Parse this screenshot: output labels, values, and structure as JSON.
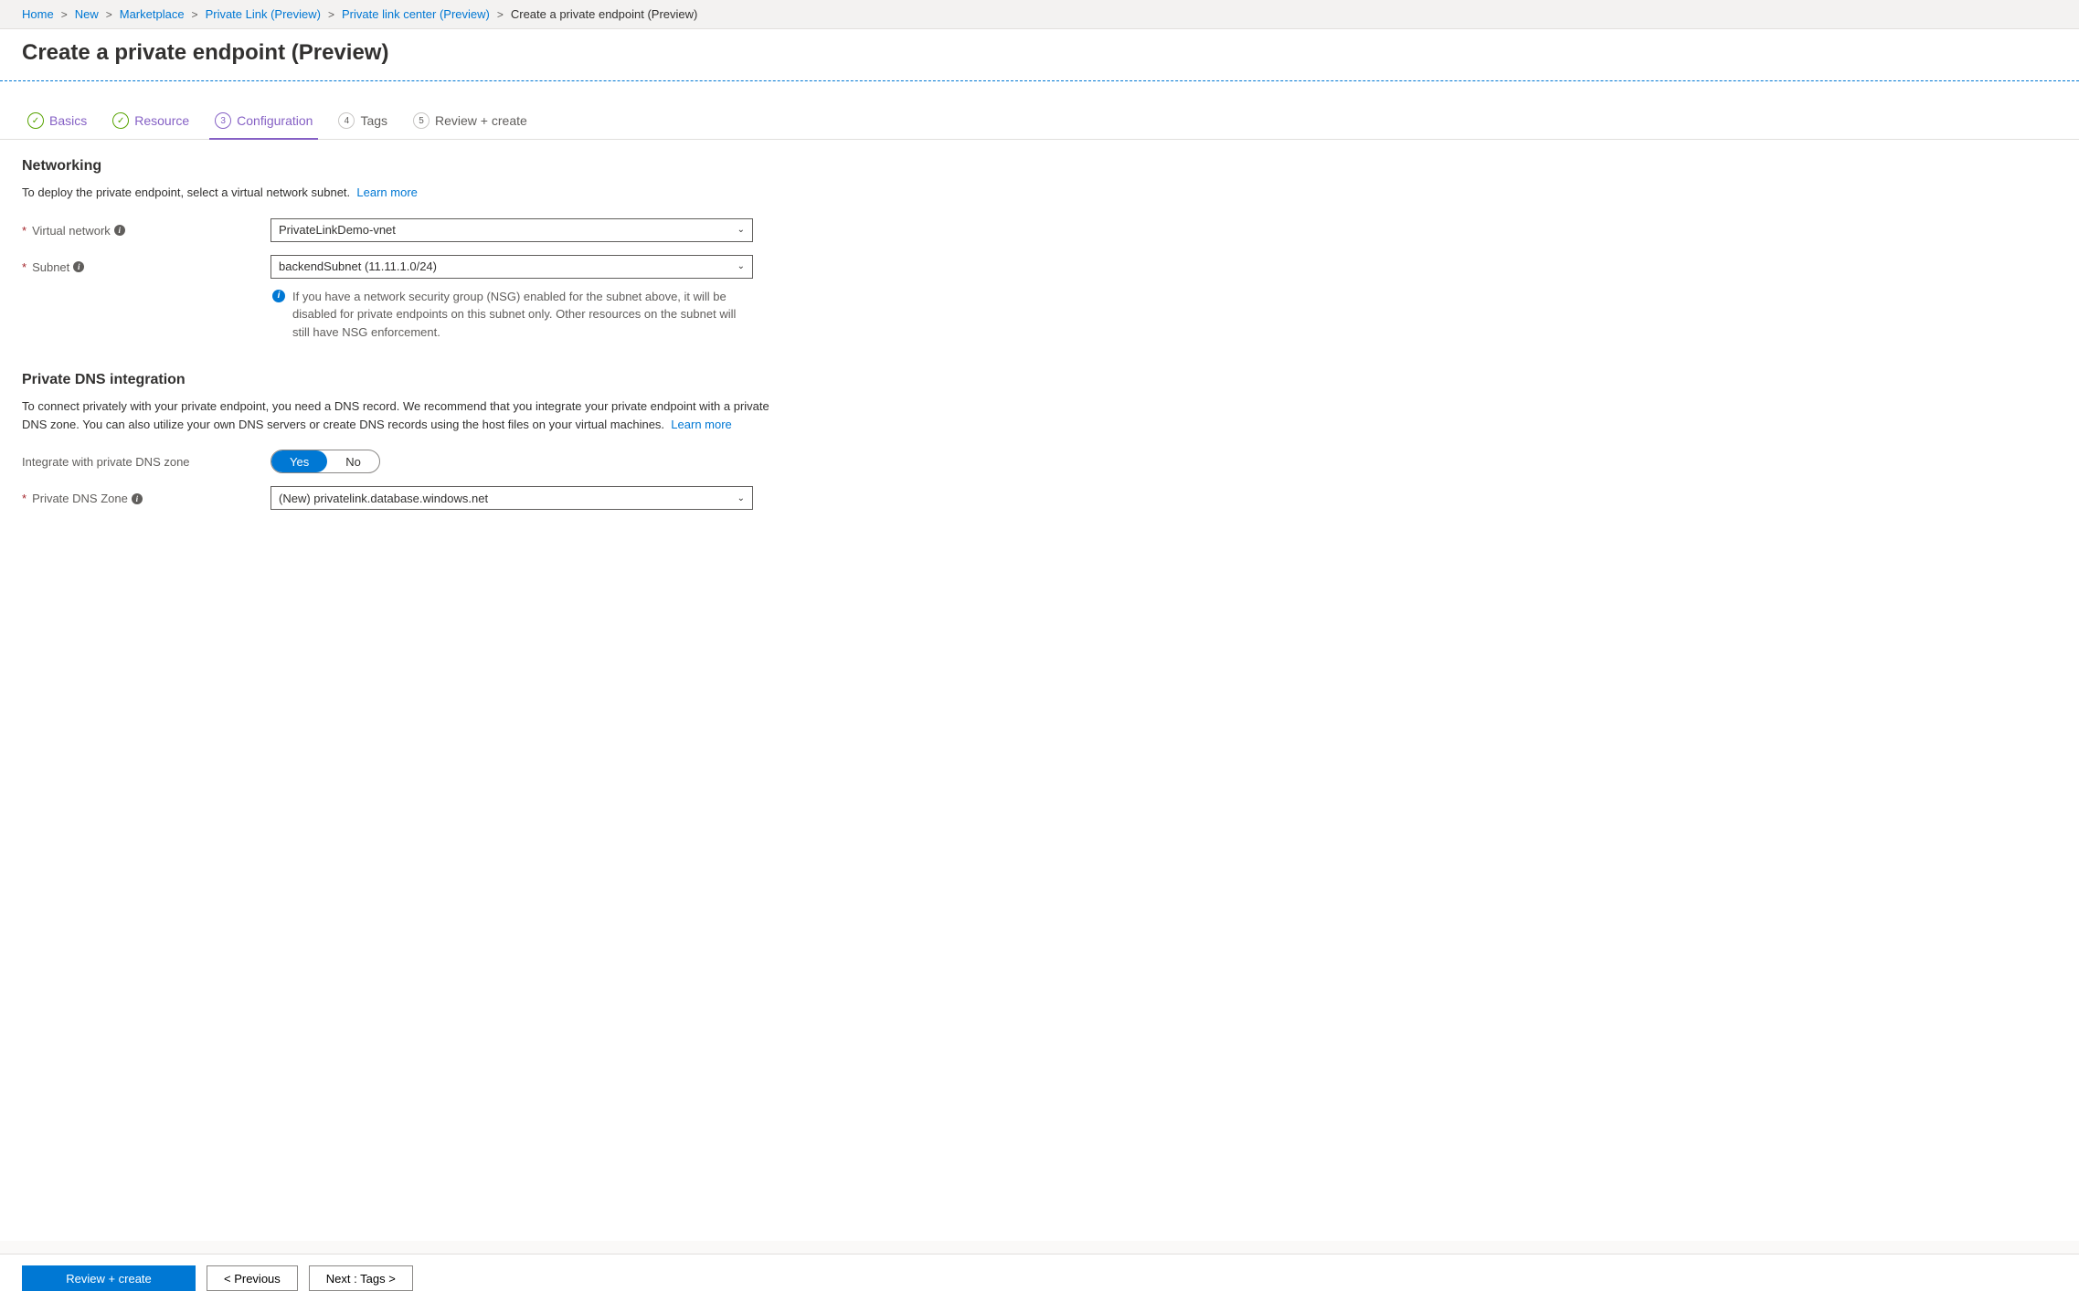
{
  "breadcrumb": {
    "items": [
      {
        "label": "Home",
        "link": true
      },
      {
        "label": "New",
        "link": true
      },
      {
        "label": "Marketplace",
        "link": true
      },
      {
        "label": "Private Link (Preview)",
        "link": true
      },
      {
        "label": "Private link center (Preview)",
        "link": true
      },
      {
        "label": "Create a private endpoint (Preview)",
        "link": false
      }
    ]
  },
  "page": {
    "title": "Create a private endpoint (Preview)"
  },
  "tabs": {
    "basics": "Basics",
    "resource": "Resource",
    "configuration": "Configuration",
    "tags": "Tags",
    "review": "Review + create",
    "n3": "3",
    "n4": "4",
    "n5": "5"
  },
  "networking": {
    "heading": "Networking",
    "description": "To deploy the private endpoint, select a virtual network subnet.",
    "learn_more": "Learn more",
    "vnet_label": "Virtual network",
    "vnet_value": "PrivateLinkDemo-vnet",
    "subnet_label": "Subnet",
    "subnet_value": "backendSubnet (11.11.1.0/24)",
    "subnet_note": "If you have a network security group (NSG) enabled for the subnet above, it will be disabled for private endpoints on this subnet only. Other resources on the subnet will still have NSG enforcement."
  },
  "dns": {
    "heading": "Private DNS integration",
    "description": "To connect privately with your private endpoint, you need a DNS record. We recommend that you integrate your private endpoint with a private DNS zone. You can also utilize your own DNS servers or create DNS records using the host files on your virtual machines.",
    "learn_more": "Learn more",
    "integrate_label": "Integrate with private DNS zone",
    "yes": "Yes",
    "no": "No",
    "zone_label": "Private DNS Zone",
    "zone_value": "(New) privatelink.database.windows.net"
  },
  "footer": {
    "review": "Review + create",
    "previous": "< Previous",
    "next": "Next : Tags >"
  }
}
